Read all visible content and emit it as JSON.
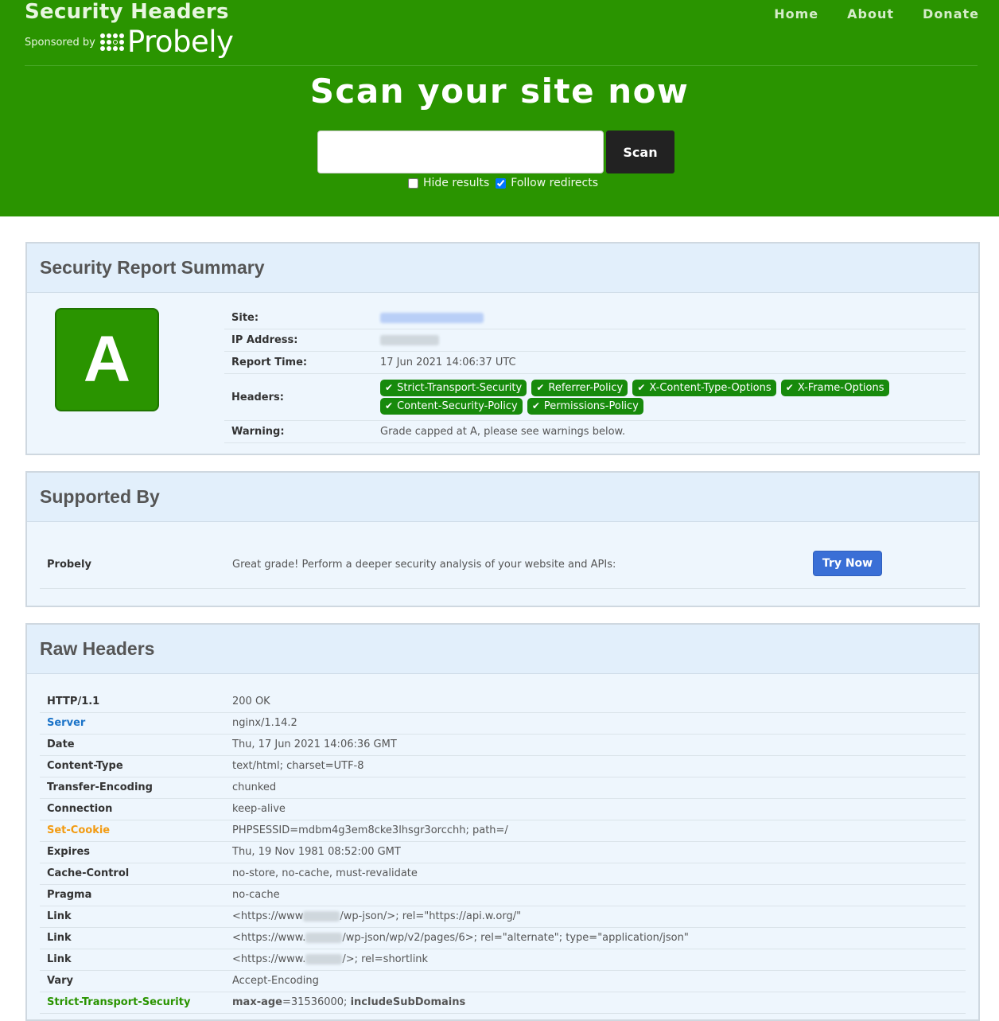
{
  "header": {
    "brand_title": "Security Headers",
    "sponsored_label": "Sponsored by",
    "sponsor_name": "Probely",
    "nav": [
      "Home",
      "About",
      "Donate"
    ],
    "hero_title": "Scan your site now",
    "scan_placeholder": "",
    "scan_button": "Scan",
    "hide_results_label": "Hide results",
    "hide_results_checked": false,
    "follow_redirects_label": "Follow redirects",
    "follow_redirects_checked": true,
    "bg_color": "#2a9400"
  },
  "summary": {
    "heading": "Security Report Summary",
    "grade": "A",
    "grade_color": "#2a9400",
    "rows": {
      "site_label": "Site:",
      "ip_label": "IP Address:",
      "report_time_label": "Report Time:",
      "report_time_value": "17 Jun 2021 14:06:37 UTC",
      "headers_label": "Headers:",
      "warning_label": "Warning:",
      "warning_value": "Grade capped at A, please see warnings below."
    },
    "headers_present": [
      "Strict-Transport-Security",
      "Referrer-Policy",
      "X-Content-Type-Options",
      "X-Frame-Options",
      "Content-Security-Policy",
      "Permissions-Policy"
    ],
    "check_icon": "check-icon"
  },
  "supported": {
    "heading": "Supported By",
    "name": "Probely",
    "text": "Great grade! Perform a deeper security analysis of your website and APIs:",
    "button": "Try Now",
    "button_color": "#3a6fd6"
  },
  "raw": {
    "heading": "Raw Headers",
    "rows": [
      {
        "key": "HTTP/1.1",
        "value": "200 OK"
      },
      {
        "key": "Server",
        "value": "nginx/1.14.2"
      },
      {
        "key": "Date",
        "value": "Thu, 17 Jun 2021 14:06:36 GMT"
      },
      {
        "key": "Content-Type",
        "value": "text/html; charset=UTF-8"
      },
      {
        "key": "Transfer-Encoding",
        "value": "chunked"
      },
      {
        "key": "Connection",
        "value": "keep-alive"
      },
      {
        "key": "Set-Cookie",
        "value": "PHPSESSID=mdbm4g3em8cke3lhsgr3orcchh; path=/"
      },
      {
        "key": "Expires",
        "value": "Thu, 19 Nov 1981 08:52:00 GMT"
      },
      {
        "key": "Cache-Control",
        "value": "no-store, no-cache, must-revalidate"
      },
      {
        "key": "Pragma",
        "value": "no-cache"
      },
      {
        "key": "Link",
        "value_prefix": "<https://www",
        "value_suffix": "/wp-json/>; rel=\"https://api.w.org/\""
      },
      {
        "key": "Link",
        "value_prefix": "<https://www.",
        "value_suffix": "/wp-json/wp/v2/pages/6>; rel=\"alternate\"; type=\"application/json\""
      },
      {
        "key": "Link",
        "value_prefix": "<https://www.",
        "value_suffix": "/>; rel=shortlink"
      },
      {
        "key": "Vary",
        "value": "Accept-Encoding"
      },
      {
        "key": "Strict-Transport-Security",
        "hsts_a": "max-age",
        "hsts_b": "=31536000; ",
        "hsts_c": "includeSubDomains"
      }
    ],
    "key_colors": {
      "info": "#1a73c8",
      "warning": "#f29b12",
      "good": "#2a9400"
    }
  }
}
